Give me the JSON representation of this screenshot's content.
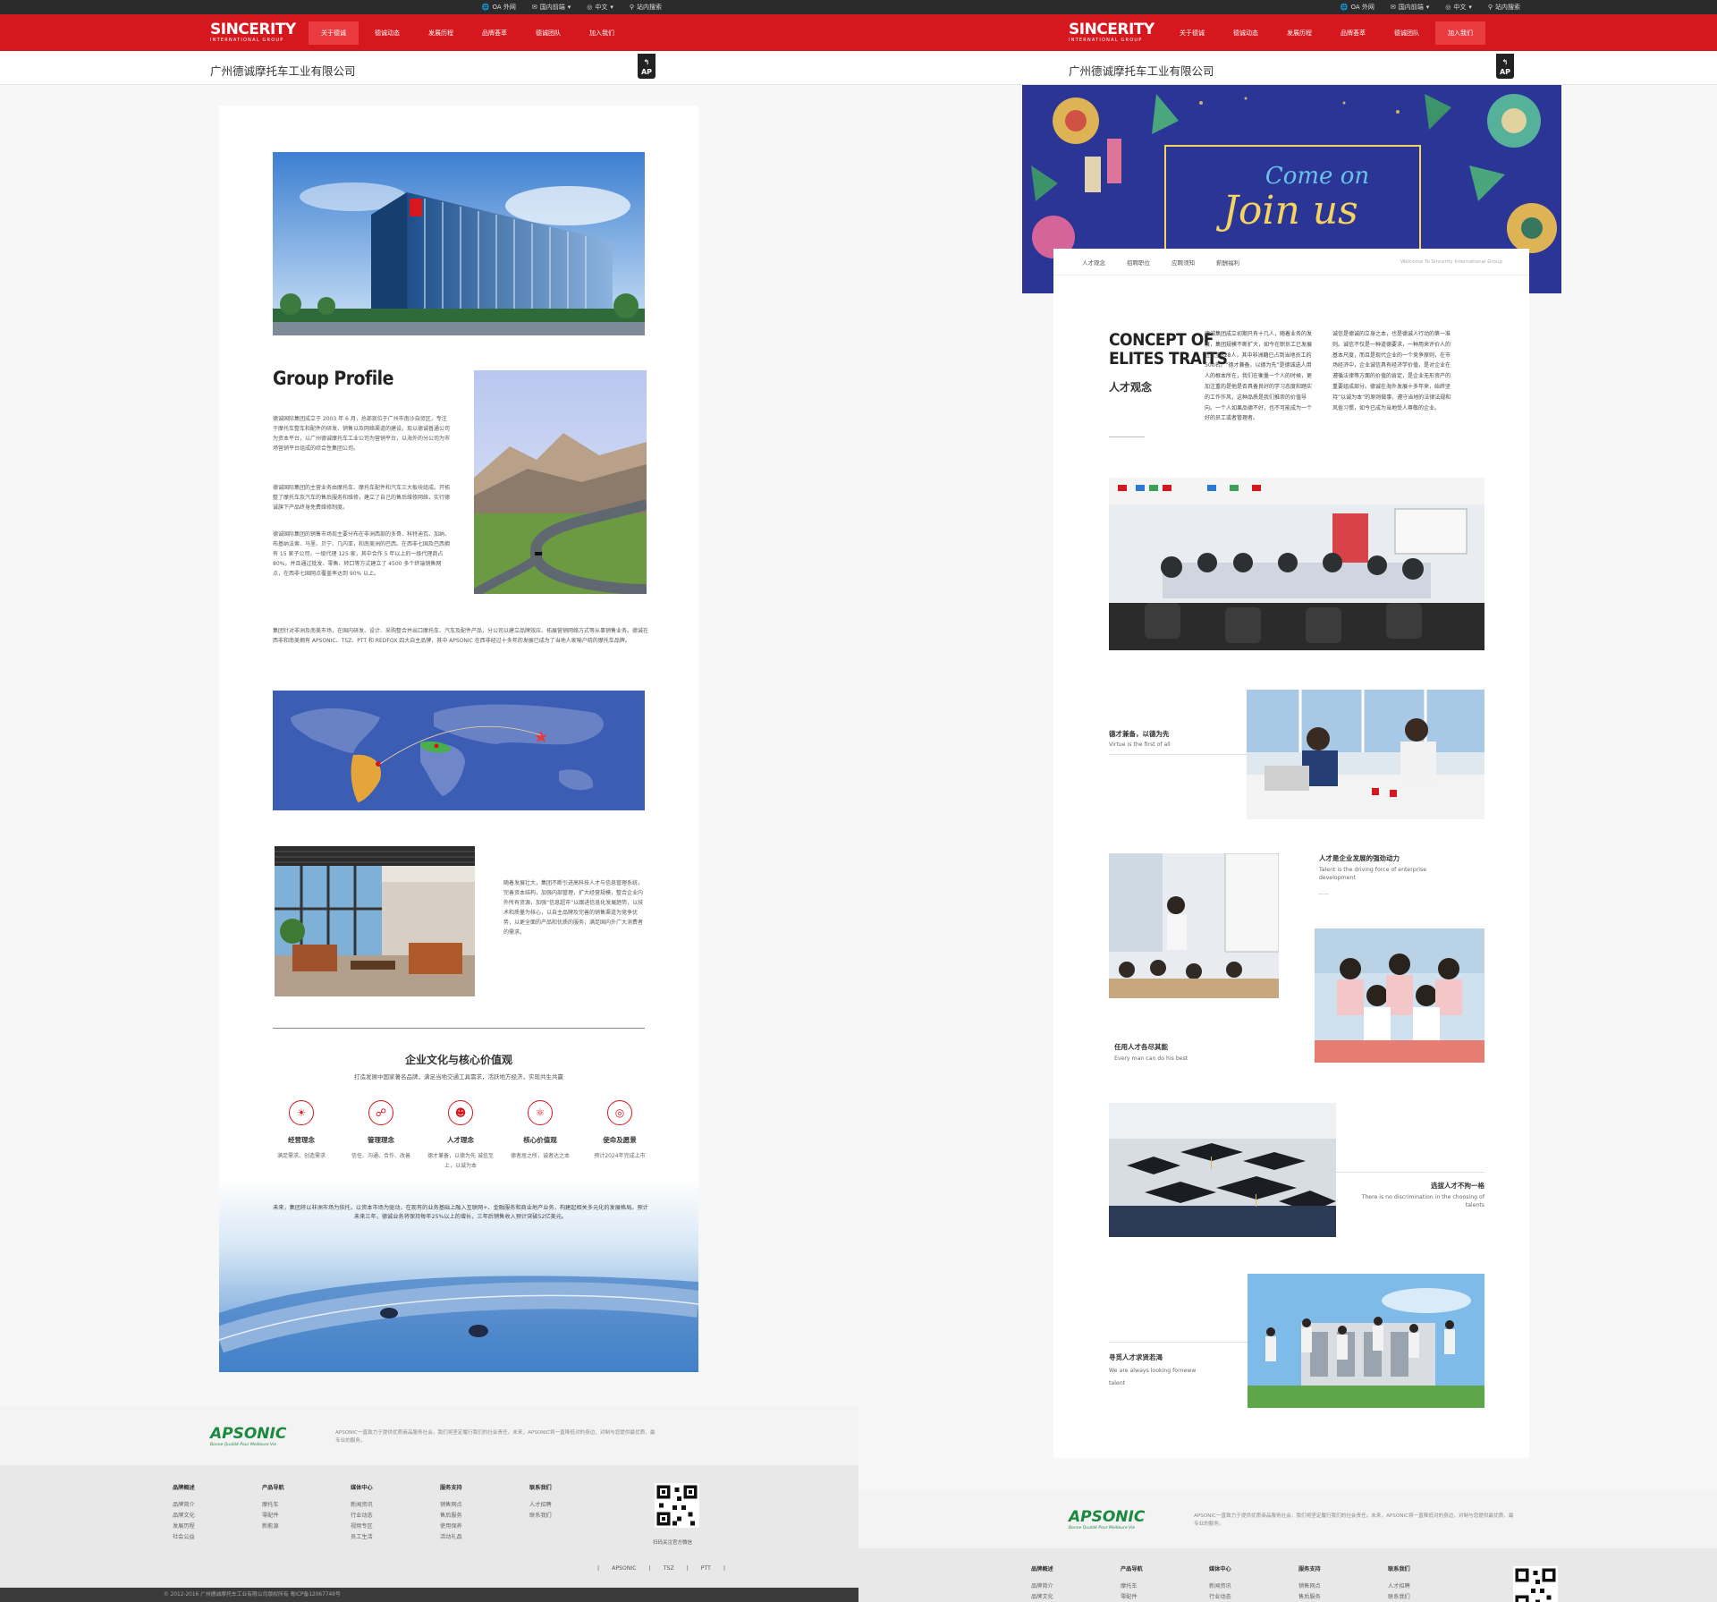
{
  "topbar": {
    "items": [
      "OA 外网",
      "国内前端",
      "中文",
      "站内搜索"
    ]
  },
  "logo": {
    "main": "SINCERITY",
    "sub": "INTERNATIONAL GROUP"
  },
  "nav": {
    "left": [
      "关于德诚",
      "德诚动态",
      "发展历程",
      "品牌荟萃",
      "德诚团队",
      "加入我们"
    ],
    "left_active": 0,
    "right": [
      "关于德诚",
      "德诚动态",
      "发展历程",
      "品牌荟萃",
      "德诚团队",
      "加入我们"
    ],
    "right_active": 5
  },
  "company_bar": {
    "title": "广州德诚摩托车工业有限公司",
    "badge": "AP"
  },
  "profile": {
    "heading": "Group Profile",
    "p1": "德诚国际集团成立于 2003 年 6 月，总部现位于广州市南沙自贸区，专注于摩托车整车和配件的研发、销售以及网络渠道的建设。现以德诚普通公司为资本平台，以广州德诚摩托车工业公司为营销平台，以海外的分公司为市场营销平台组成的综合性集团公司。",
    "p2": "德诚国际集团的主营业务由摩托车、摩托车配件和汽车三大板块组成。开拓整了摩托车及汽车的售后服务和维修，建立了自己的售后维修网络，实行德诚旗下产品终身免费维修制度。",
    "p3": "德诚国际集团的销售市场现主要分布在非洲西部的多哥、科特迪瓦、加纳、布基纳法索、马里、贝宁、几内亚，和南美洲的巴西。在西非七国及巴西拥有 15 家子公司，一级代理 125 家，其中合作 5 年以上的一级代理商占 80%，并且通过批发、零售、转口等方式建立了 4500 多个终端销售网点，在西非七国网点覆盖率达到 90% 以上。",
    "p4": "集团针对非洲及南美市场，在国内研发、设计、采购整合并出口摩托车、汽车及配件产品，分公司以建立品牌效应、拓展营销网络方式等从事销售业务。德诚在西非和南美拥有 APSONIC、TSZ、PTT 和 REDFOX 四大自主品牌，其中 APSONIC 在西非经过十多年的发展已成为了当地人家喻户晓的摩托车品牌。",
    "p5": "随着发展壮大，集团不断引进高科技人才与信息管理系统，完善资本结构，加强内部管理，扩大经营规模，整合企业内外所有资源，加强“信息超市”以跟进信息化发展趋势，以技术和质量为核心，以自主品牌及完善的销售渠道为竞争优势，以更全面的产品和优质的服务，满足国内外广大消费者的需求。"
  },
  "culture": {
    "title": "企业文化与核心价值观",
    "subtitle": "打造发展中国家著名品牌，满足当地交通工具需求，活跃地方经济，实现共生共赢",
    "values": [
      {
        "icon": "bulb-icon",
        "title": "经营理念",
        "desc": "满足需求、创造需求"
      },
      {
        "icon": "team-icon",
        "title": "管理理念",
        "desc": "信任、沟通、合作、改善"
      },
      {
        "icon": "people-icon",
        "title": "人才理念",
        "desc": "德才兼备，以德为先 诚信至上，以诚为本"
      },
      {
        "icon": "atom-icon",
        "title": "核心价值观",
        "desc": "德者居之所，诚者达之本"
      },
      {
        "icon": "target-icon",
        "title": "使命及愿景",
        "desc": "预计2024年完成上市"
      }
    ],
    "future": "未来，集团将以非洲市场为依托，以资本市场为驱动，在现有的业务基础上融入互联网+、金融服务和商业地产业务，构建起相关多元化的发展格局。预计未来三年，德诚业务将保持每年25%以上的增长，三年后销售收入预计突破52亿美元。"
  },
  "join": {
    "banner_line1": "Come on",
    "banner_line2": "Join us",
    "tabs": [
      "人才观念",
      "招聘职位",
      "应聘须知",
      "薪酬福利"
    ],
    "welcome": "Welcome To Sincerity International Group",
    "concept_en_1": "CONCEPT OF",
    "concept_en_2": "ELITES TRAITS",
    "concept_cn": "人才观念",
    "col1": "德诚集团成立初期只有十几人，随着业务的发展，集团规模不断扩大，如今在职员工已发展壮大至628人，其中非洲籍已占到当地员工的500名。“德才兼备，以德为先”是德诚选人用人的根本所在，我们在衡量一个人的时候，更加注重的是他是否具备良好的学习态度和踏实的工作作风，这种品质是我们推崇的价值导向。一个人如果品德不好，也不可能成为一个好的员工或者管理者。",
    "col2": "诚信是德诚的立身之本，也是德诚人行动的第一准则。诚信不仅是一种道德要求，一种用来评价人的基本尺度，而且是现代企业的一个竞争原则，在市场经济中，企业诚信具有经济学价值，是对企业在遵循法律等方面的价值的肯定，是企业无形资产的重要组成部分。德诚在海外发展十多年来，始终坚持“以诚为本”的原则做事，遵守当地的法律法规和风俗习惯，如今已成为当地受人尊敬的企业。",
    "items": [
      {
        "cn": "德才兼备，以德为先",
        "en": "Virtue is the first of all"
      },
      {
        "cn": "人才是企业发展的强劲动力",
        "en": "Talent is the driving force of enterprise development"
      },
      {
        "cn": "任用人才各尽其能",
        "en": "Every man can do his best"
      },
      {
        "cn": "选拔人才不拘一格",
        "en": "There is no discrimination in the choosing of talents"
      },
      {
        "cn": "寻觅人才求贤若渴",
        "en": "We are always looking forneww talent"
      }
    ]
  },
  "brand": {
    "logo": "APSONIC",
    "tagline": "Bonne Qualité Pour Meilleure Vie",
    "text": "APSONIC一直致力于提供优质商品服务社会，我们将坚定履行我们的社会责任。未来，APSONIC将一直降低对的身边，对制与您提供最优质、最专业的服务。"
  },
  "footer": {
    "cols": [
      {
        "title": "品牌概述",
        "items": [
          "品牌简介",
          "品牌文化",
          "发展历程",
          "社会公益"
        ]
      },
      {
        "title": "产品导航",
        "items": [
          "摩托车",
          "零配件",
          "新能源"
        ]
      },
      {
        "title": "媒体中心",
        "items": [
          "新闻资讯",
          "行业动态",
          "视频专区",
          "员工生活"
        ]
      },
      {
        "title": "服务支持",
        "items": [
          "销售网点",
          "售后服务",
          "使用保养",
          "活动礼品"
        ]
      },
      {
        "title": "联系我们",
        "items": [
          "人才招聘",
          "联系我们"
        ]
      }
    ],
    "qr_caption": "扫码关注官方微信",
    "links": [
      "APSONIC",
      "TSZ",
      "PTT"
    ],
    "copyright": "© 2012-2016 广州德诚摩托车工业有限公司版权所有 粤ICP备12067749号"
  },
  "colors": {
    "brand_red": "#d6171e",
    "apsonic_green": "#1c8a3e"
  }
}
